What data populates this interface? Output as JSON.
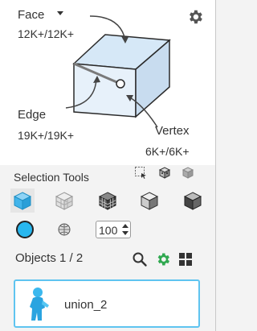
{
  "selection_panel": {
    "mode_dropdown": "Face",
    "face_count": "12K+/12K+",
    "edge_label": "Edge",
    "edge_count": "19K+/19K+",
    "vertex_label": "Vertex",
    "vertex_count": "6K+/6K+"
  },
  "selection_tools": {
    "title": "Selection Tools",
    "brush_size_value": "100"
  },
  "objects": {
    "label": "Objects 1 / 2",
    "items": [
      {
        "name": "union_2"
      }
    ]
  },
  "colors": {
    "accent": "#28b7ef",
    "selected_border": "#5fc4f0",
    "gear_active": "#2fa84f",
    "cube_face": "#cfe3f4"
  },
  "icons": [
    "gear-icon",
    "marquee-select-icon",
    "cube-select-icon",
    "cube-select-gray-icon",
    "solid-cube-icon",
    "wire-cube-icon",
    "grid-cube-icon",
    "outline-cube-icon",
    "split-cube-icon",
    "color-circle-icon",
    "sphere-brush-icon",
    "spinner-icon",
    "search-icon",
    "settings-green-icon",
    "grid-view-icon",
    "figure-thumbnail-icon"
  ]
}
